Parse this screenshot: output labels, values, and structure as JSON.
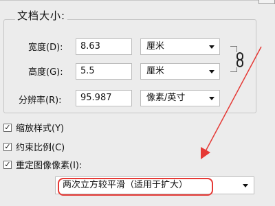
{
  "dialog": {
    "group_title": "文档大小:",
    "fields": [
      {
        "label": "宽度(D):",
        "value": "8.63",
        "unit": "厘米"
      },
      {
        "label": "高度(G):",
        "value": "5.5",
        "unit": "厘米"
      },
      {
        "label": "分辨率(R):",
        "value": "95.987",
        "unit": "像素/英寸"
      }
    ],
    "checkboxes": [
      {
        "label": "缩放样式(Y)",
        "checked": true
      },
      {
        "label": "约束比例(C)",
        "checked": true
      },
      {
        "label": "重定图像像素(I):",
        "checked": true
      }
    ],
    "resample_method": "两次立方较平滑（适用于扩大）"
  },
  "colors": {
    "highlight": "#e53935",
    "background": "#ececec"
  },
  "icons": {
    "link": "chain-link-icon",
    "dropdown": "chevron-down-icon",
    "checked": "checkmark-icon"
  }
}
